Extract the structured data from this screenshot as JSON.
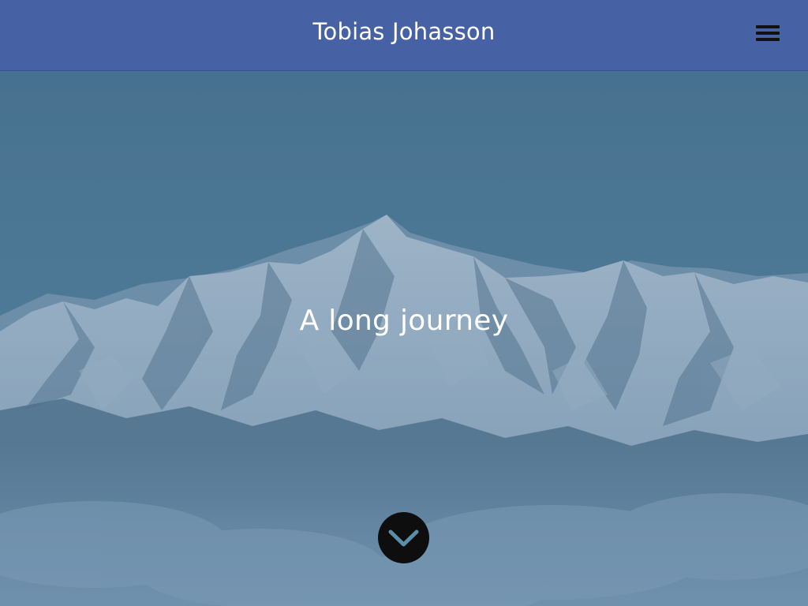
{
  "header": {
    "site_title": "Tobias Johasson",
    "menu_icon": "hamburger-menu-icon"
  },
  "hero": {
    "tagline": "A long journey",
    "background_image": "snowy-mountain-range",
    "scroll_icon": "chevron-down-icon"
  },
  "colors": {
    "header_bg": "#4662a5",
    "overlay": "#4d6f8d",
    "text": "#ffffff",
    "scroll_button": "#0e0e0e",
    "chevron": "#5b8fa8"
  }
}
